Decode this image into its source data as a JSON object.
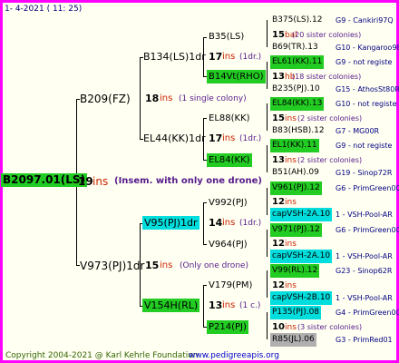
{
  "header": {
    "date": "1-  4-2021  ( 11:  25)"
  },
  "footer": {
    "copyright": "Copyright 2004-2021 @ Karl Kehrle Foundation",
    "site": "www.pedigreeapis.org"
  },
  "colors": {
    "green": "#22cc22",
    "cyan": "#00dddd",
    "gray": "#b0b0b0",
    "red": "#cc2200",
    "blue": "#0000cc",
    "purple": "#551a8b",
    "dark": "#000080"
  },
  "root": {
    "id": "B2097.01(LS)",
    "gen": "19",
    "ins": "ins",
    "note": "(Insem. with only one drone)"
  },
  "gen1": [
    {
      "id": "B209(FZ)",
      "gen": "18",
      "ins": "ins",
      "note": "(1 single colony)"
    },
    {
      "id": "V973(PJ)1dr",
      "gen": "15",
      "ins": "ins",
      "note": "(Only one drone)"
    }
  ],
  "gen2": [
    {
      "id": "B134(LS)1dr",
      "gen": "17",
      "ins": "ins",
      "note": "(1dr.)"
    },
    {
      "id": "EL44(KK)1dr",
      "gen": "17",
      "ins": "ins",
      "note": "(1dr.)"
    },
    {
      "id": "V95(PJ)1dr",
      "gen": "14",
      "ins": "ins",
      "note": "(1dr.)"
    },
    {
      "id": "V154H(RL)",
      "gen": "13",
      "ins": "ins",
      "note": "(1 c.)"
    }
  ],
  "gen3": [
    {
      "id": "B35(LS)"
    },
    {
      "id": "B14Vt(RHO)"
    },
    {
      "id": "EL88(KK)"
    },
    {
      "id": "EL84(KK)"
    },
    {
      "id": "V992(PJ)"
    },
    {
      "id": "V964(PJ)"
    },
    {
      "id": "V179(PM)"
    },
    {
      "id": "P214(PJ)"
    }
  ],
  "gen4": [
    {
      "id": "B375(LS).12",
      "info": "G9 - Cankiri97Q"
    },
    {
      "gen": "15",
      "ins": "bal",
      "note": "(20 sister colonies)"
    },
    {
      "id": "B69(TR).13",
      "info": "G10 - Kangaroo98R"
    },
    {
      "id": "EL61(KK).11",
      "info": "G9 - not registe"
    },
    {
      "gen": "13",
      "ins": "hb",
      "note": "(18 sister colonies)"
    },
    {
      "id": "B235(PJ).10",
      "info": "G15 - AthosSt80R"
    },
    {
      "id": "EL84(KK).13",
      "info": "G10 - not registe"
    },
    {
      "gen": "15",
      "ins": "ins",
      "note": "(2 sister colonies)"
    },
    {
      "id": "B83(HSB).12",
      "info": "G7 - MG00R"
    },
    {
      "id": "EL1(KK).11",
      "info": "G9 - not registe"
    },
    {
      "gen": "13",
      "ins": "ins",
      "note": "(2 sister colonies)"
    },
    {
      "id": "B51(AH).09",
      "info": "G19 - Sinop72R"
    },
    {
      "id": "V961(PJ).12",
      "info": "G6 - PrimGreen00"
    },
    {
      "gen": "12",
      "ins": "ins",
      "note": ""
    },
    {
      "id": "capVSH-2A.10",
      "info": "1 - VSH-Pool-AR"
    },
    {
      "id": "V971(PJ).12",
      "info": "G6 - PrimGreen00"
    },
    {
      "gen": "12",
      "ins": "ins",
      "note": ""
    },
    {
      "id": "capVSH-2A.10",
      "info": "1 - VSH-Pool-AR"
    },
    {
      "id": "V99(RL).12",
      "info": "G23 - Sinop62R"
    },
    {
      "gen": "12",
      "ins": "ins",
      "note": ""
    },
    {
      "id": "capVSH-2B.10",
      "info": "1 - VSH-Pool-AR"
    },
    {
      "id": "P135(PJ).08",
      "info": "G4 - PrimGreen00"
    },
    {
      "gen": "10",
      "ins": "ins",
      "note": "(3 sister colonies)"
    },
    {
      "id": "R85(JL).06",
      "info": "G3 - PrimRed01"
    }
  ]
}
